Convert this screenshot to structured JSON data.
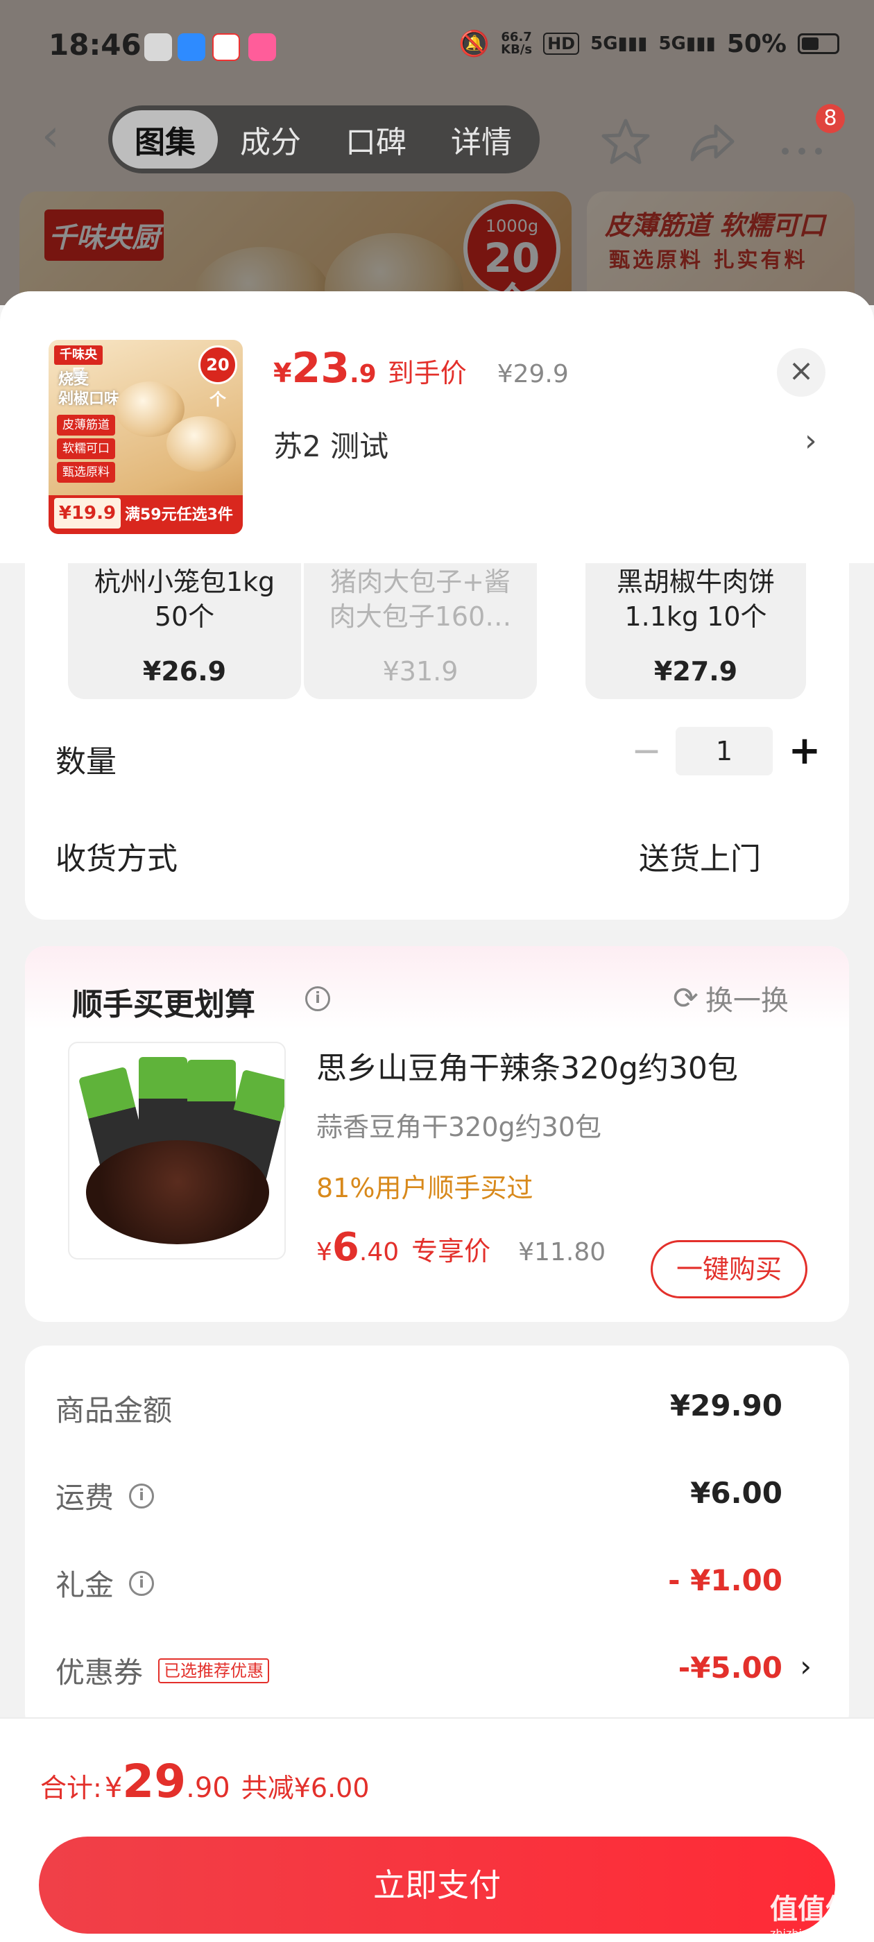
{
  "status_bar": {
    "time": "18:46",
    "net_speed_value": "66.7",
    "net_speed_unit": "KB/s",
    "battery": "50%"
  },
  "nav": {
    "tabs": [
      "图集",
      "成分",
      "口碑",
      "详情"
    ],
    "active_tab": 0,
    "more_badge": "8"
  },
  "background": {
    "brand_logo": "千味央厨",
    "bubble_weight": "1000g",
    "bubble_count": "20个",
    "banner2_title": "皮薄筋道 软糯可口",
    "banner2_sub": "甄选原料 扎实有料"
  },
  "product": {
    "thumb": {
      "logo": "千味央厨",
      "title": "烧麦\n剁椒口味",
      "bubble": "20个",
      "tags": [
        "皮薄筋道",
        "软糯可口",
        "甄选原料"
      ],
      "price": "¥19.9",
      "promo": "满59元任选3件"
    },
    "price_currency": "¥",
    "price_int": "23",
    "price_dec": ".9",
    "price_label": "到手价",
    "original_price": "¥29.9",
    "variant": "苏2  测试"
  },
  "variants": [
    {
      "name": "杭州小笼包1kg\n50个",
      "price": "¥26.9",
      "disabled": false
    },
    {
      "name": "猪肉大包子+酱\n肉大包子160…",
      "price": "¥31.9",
      "disabled": true
    },
    {
      "name": "黑胡椒牛肉饼\n1.1kg 10个",
      "price": "¥27.9",
      "disabled": false
    }
  ],
  "quantity": {
    "label": "数量",
    "minus": "−",
    "value": "1",
    "plus": "+"
  },
  "shipping": {
    "label": "收货方式",
    "value": "送货上门"
  },
  "addon": {
    "title": "顺手买更划算",
    "refresh_label": "换一换",
    "product_name": "思乡山豆角干辣条320g约30包",
    "product_sub": "蒜香豆角干320g约30包",
    "social_proof": "81%用户顺手买过",
    "price_currency": "¥",
    "price_int": "6",
    "price_dec": ".40",
    "price_label": "专享价",
    "original_price": "¥11.80",
    "buy_label": "一键购买"
  },
  "summary": {
    "rows": [
      {
        "label": "商品金额",
        "value": "¥29.90"
      },
      {
        "label": "运费",
        "value": "¥6.00"
      },
      {
        "label": "礼金",
        "value": "- ¥1.00"
      },
      {
        "label": "优惠券",
        "tag": "已选推荐优惠",
        "value": "-¥5.00"
      }
    ]
  },
  "total": {
    "label": "合计:",
    "currency": "¥",
    "int": "29",
    "dec": ".90",
    "saved": "共减¥6.00"
  },
  "pay_button": "立即支付",
  "watermark": {
    "main": "值值值",
    "sub": "zhizhizhi.com"
  },
  "colors": {
    "accent_red": "#e3302b",
    "social_orange": "#d8891b",
    "pay_gradient_start": "#f04048",
    "pay_gradient_end": "#ff2a36"
  }
}
